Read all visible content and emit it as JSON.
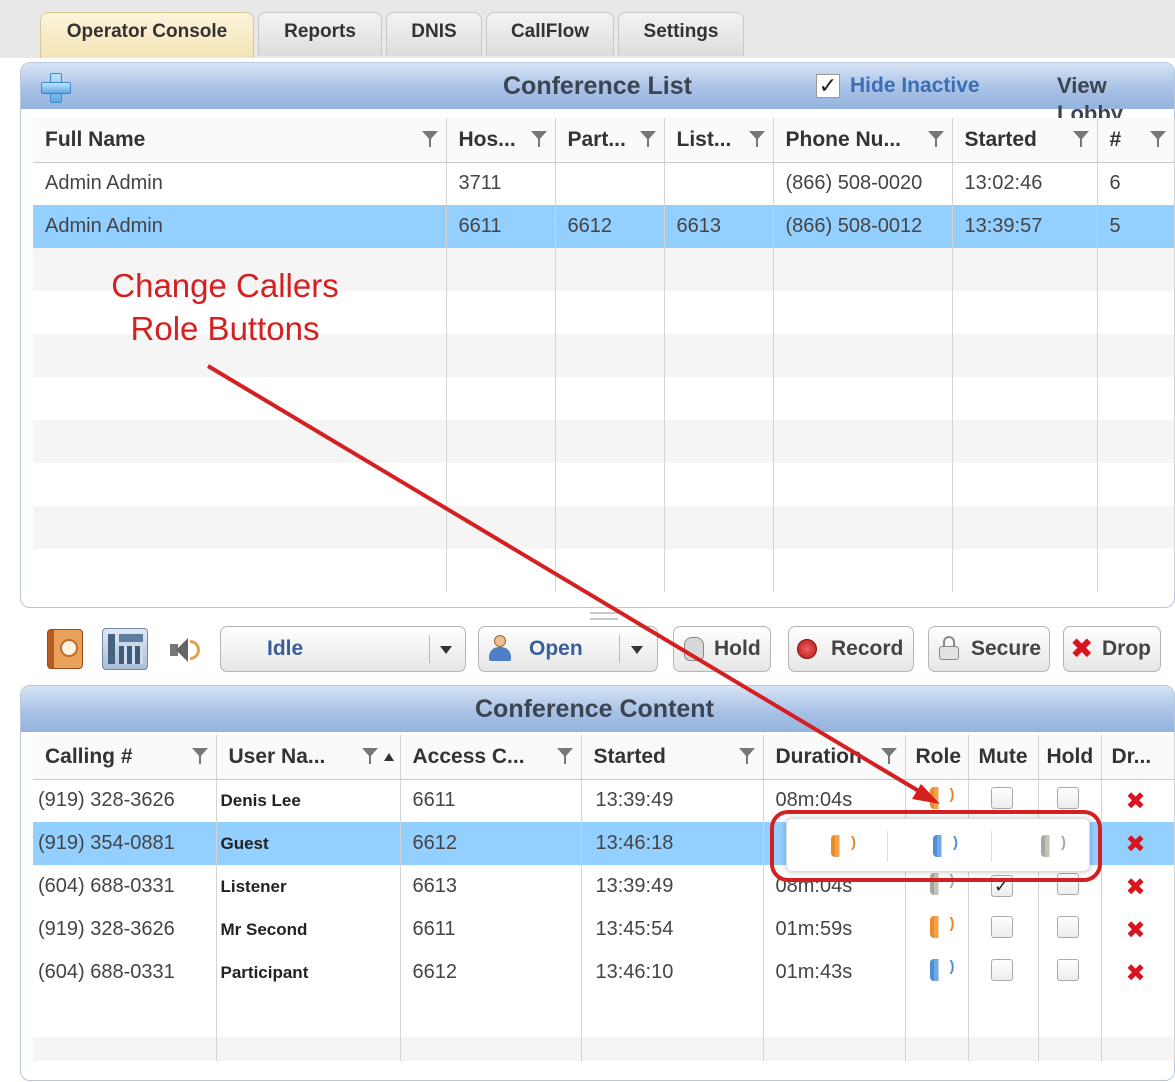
{
  "tabs": [
    {
      "label": "Operator Console",
      "active": true
    },
    {
      "label": "Reports",
      "active": false
    },
    {
      "label": "DNIS",
      "active": false
    },
    {
      "label": "CallFlow",
      "active": false
    },
    {
      "label": "Settings",
      "active": false
    }
  ],
  "conference_list": {
    "title": "Conference List",
    "hide_inactive_label": "Hide Inactive",
    "hide_inactive_checked": true,
    "view_lobby_label": "View Lobby",
    "columns": [
      "Full Name",
      "Hos...",
      "Part...",
      "List...",
      "Phone Nu...",
      "Started",
      "#"
    ],
    "rows": [
      {
        "full_name": "Admin Admin",
        "host": "3711",
        "participant": "",
        "listener": "",
        "phone": "(866) 508-0020",
        "started": "13:02:46",
        "count": "6",
        "selected": false
      },
      {
        "full_name": "Admin Admin",
        "host": "6611",
        "participant": "6612",
        "listener": "6613",
        "phone": "(866) 508-0012",
        "started": "13:39:57",
        "count": "5",
        "selected": true
      }
    ]
  },
  "annotation": {
    "line1": "Change Callers",
    "line2": "Role Buttons",
    "color": "#d42020"
  },
  "toolbar": {
    "status_select": "Idle",
    "open_label": "Open",
    "hold_label": "Hold",
    "record_label": "Record",
    "secure_label": "Secure",
    "drop_label": "Drop"
  },
  "conference_content": {
    "title": "Conference Content",
    "columns": [
      "Calling #",
      "User Na...",
      "Access C...",
      "Started",
      "Duration",
      "Role",
      "Mute",
      "Hold",
      "Dr..."
    ],
    "rows": [
      {
        "calling": "(919) 328-3626",
        "user": "Denis Lee",
        "access": "6611",
        "started": "13:39:49",
        "duration": "08m:04s",
        "role": "host",
        "mute": false,
        "hold": false,
        "selected": false
      },
      {
        "calling": "(919) 354-0881",
        "user": "Guest",
        "access": "6612",
        "started": "13:46:18",
        "duration": "",
        "role": "",
        "mute": false,
        "hold": false,
        "selected": true
      },
      {
        "calling": "(604) 688-0331",
        "user": "Listener",
        "access": "6613",
        "started": "13:39:49",
        "duration": "08m:04s",
        "role": "listener",
        "mute": true,
        "hold": false,
        "selected": false
      },
      {
        "calling": "(919) 328-3626",
        "user": "Mr Second",
        "access": "6611",
        "started": "13:45:54",
        "duration": "01m:59s",
        "role": "host",
        "mute": false,
        "hold": false,
        "selected": false
      },
      {
        "calling": "(604) 688-0331",
        "user": "Participant",
        "access": "6612",
        "started": "13:46:10",
        "duration": "01m:43s",
        "role": "participant",
        "mute": false,
        "hold": false,
        "selected": false
      }
    ],
    "role_popup": [
      "host",
      "participant",
      "listener"
    ]
  },
  "colors": {
    "header_blue": "#a9c2e6",
    "selected_row": "#93cfff",
    "active_tab": "#f3e3b5",
    "drop_red": "#d8141e",
    "host_role": "#e98a2b",
    "participant_role": "#4f8fd3",
    "listener_role": "#a8a89c"
  }
}
